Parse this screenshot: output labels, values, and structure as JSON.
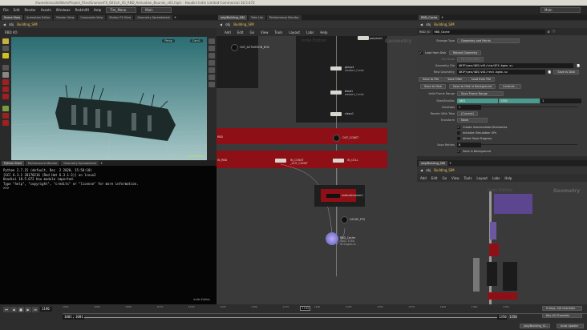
{
  "window": {
    "title": "/home/kriscold/Work/Project_Files/GnomonFX_001/ch_05_RBD_Activation_Bounds_v01.hiplc - Houdini Indie Limited-Commercial 18.5.672"
  },
  "menu": {
    "items": [
      "File",
      "Edit",
      "Render",
      "Assets",
      "Windows",
      "RedshiftI",
      "Help"
    ],
    "desktop": "Tim_Mono",
    "desktop2": "Main",
    "desktop_right": "Main"
  },
  "left_tabs": [
    "Scene View",
    "Animation Editor",
    "Render View",
    "Composite View",
    "Motion FX View",
    "Geometry Spreadsheet"
  ],
  "left_path": {
    "root": "obj",
    "node": "Building_SIM"
  },
  "viewport": {
    "title": "RBD I/O",
    "camera": "Persp",
    "cam": "Cam1",
    "watermark": "Indie Edition"
  },
  "shell_tabs": [
    "Python Shell",
    "Performance Monitor",
    "Geometry Spreadsheet"
  ],
  "shell_lines": [
    "Python 2.7.15 (default, Dec  2 2020, 15:50:18)",
    "[GCC 6.3.1 20170216 (Red Hat 6.3.1-3)] on linux2",
    "Houdini 18.5.672 hou module imported.",
    "Type \"help\", \"copyright\", \"credits\" or \"license\" for more information.",
    ">>>"
  ],
  "shell_watermark": "Indie Edition",
  "mid_tabs": [
    "/obj/Building_SIM",
    "Take List",
    "Performance Monitor"
  ],
  "mid_path": {
    "root": "obj",
    "node": "Building_SIM"
  },
  "net_menu": [
    "Add",
    "Edit",
    "Go",
    "View",
    "Tools",
    "Layout",
    "Labs",
    "Help"
  ],
  "network": {
    "watermark": "Indie Edition",
    "context": "Geometry",
    "nodes": {
      "out_activation": "OUT_ACTIVATION_BOX",
      "polywire": "polywire1",
      "group": "group1",
      "group_sub": "weaken_Const",
      "blast": "blast1",
      "blast_sub": "weaken_Const",
      "clean": "clean1",
      "out_const": "OUT_CONST",
      "in_rbd": "IN_RBD",
      "in_const": "IN_CONST",
      "in_const_sub": "_OUT_CONST",
      "in_coll": "IN_COLL",
      "solver": "rbdbulletsolver1",
      "cache_pts": "CACHE_PTS",
      "rbd_cache": "RBD_Cache",
      "rbd_cache_sub": "1001 1350",
      "rbd_cache_file": "$F4.bgeo.sc",
      "rbd_label": "RBD"
    }
  },
  "right_tabs": [
    "RBD_Cache"
  ],
  "right_path": {
    "root": "obj",
    "node": "Building_SIM"
  },
  "params": {
    "node_type": "RBD I/O",
    "node_name": "RBD_Cache",
    "storage_type_label": "Storage Type",
    "storage_type": "Geometry and Points",
    "load_from_disk": "Load from Disk",
    "reload": "Reload Geometry",
    "file_mode_label": "File Mode",
    "file_mode": "No Operation",
    "geo_file_label": "Geometry File",
    "geo_file": "$HIP/geo/$OS/v01/sim/$F4.bgeo.sc",
    "rest_label": "Rest Geometry",
    "rest_file": "$HIP/geo/$OS/v01/rest.bgeo.sc",
    "save_to_disk_top": "Save to Disk",
    "subtabs": [
      "Save to File",
      "Save Filter",
      "Load from File"
    ],
    "save_to_disk": "Save to Disk",
    "save_bg": "Save to Disk in Background",
    "controls": "Controls...",
    "frame_range_label": "Valid Frame Range",
    "frame_range": "Save Frame Range",
    "start_end_label": "Start/End/Inc",
    "start": "1001",
    "end": "1350",
    "inc": "1",
    "substeps_label": "Substeps",
    "substeps": "1",
    "take_label": "Render With Take",
    "take": "(Current)",
    "transform_label": "Transform",
    "transform": "None",
    "create_dirs": "Create Intermediate Directories",
    "init_sim": "Initialize Simulation OPs",
    "alfred": "Alfred Style Progress",
    "retries_label": "Save Retries",
    "retries": "0",
    "save_bg_chk": "Save in Background"
  },
  "lower_tabs": [
    "/obj/Building_SIM"
  ],
  "lower_path": {
    "root": "obj",
    "node": "Building_SIM"
  },
  "lower_net": {
    "watermark": "Indie Edition",
    "context": "Geometry"
  },
  "timeline": {
    "frame": "1190",
    "ticks": [
      "1001",
      "1025",
      "1050",
      "1075",
      "1100",
      "1125",
      "1150",
      "1175",
      "1200",
      "1225",
      "1250",
      "1275",
      "1300",
      "1325",
      "1350"
    ],
    "current": "1190",
    "range_start": "1001",
    "range_start2": "1001",
    "range_end": "1350",
    "range_end2": "1350",
    "keys": "0 keys, 0/0 channels",
    "key_all": "Key All Channels",
    "scope": "/obj/Building_SI...",
    "auto_update": "Auto Update",
    "playhead_fraction": 0.54
  }
}
